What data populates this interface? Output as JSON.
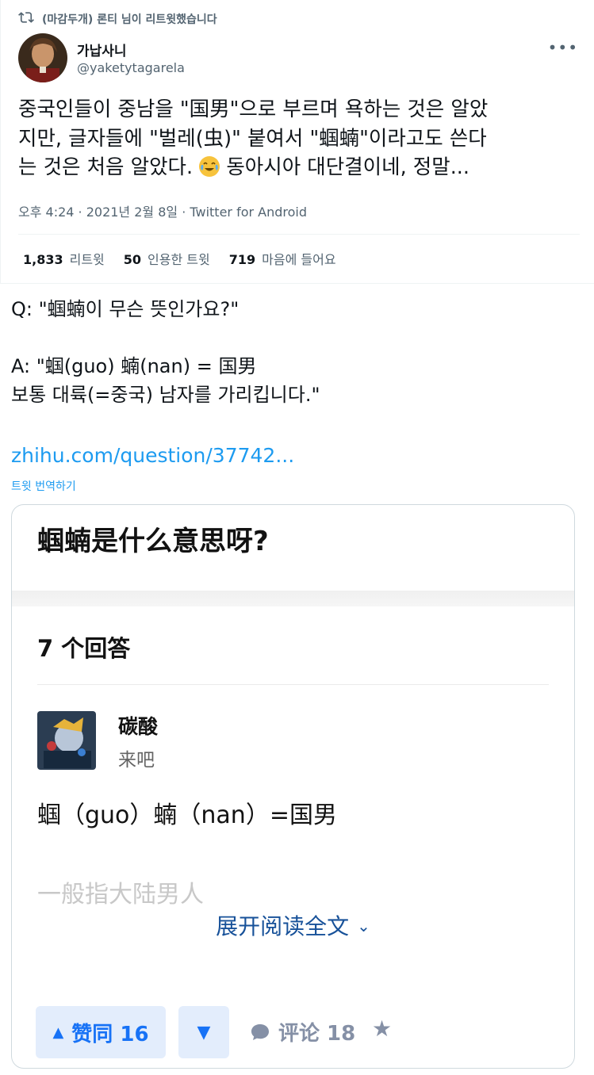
{
  "tweet": {
    "retweet_label": "(마감두개) 론티 님이 리트윗했습니다",
    "display_name": "가납사니",
    "handle": "@yaketytagarela",
    "more": "•••",
    "text_line1": "중국인들이 중남을 \"国男\"으로 부르며 욕하는 것은 알았",
    "text_line2": "지만, 글자들에 \"벌레(虫)\" 붙여서 \"蝈蝻\"이라고도 쓴다",
    "text_line3_a": "는 것은 처음 알았다.",
    "text_line3_b": "동아시아 대단결이네, 정말...",
    "emoji": "face-with-tears-of-joy",
    "meta": "오후 4:24 · 2021년 2월 8일 · Twitter for Android",
    "stats": [
      {
        "count": "1,833",
        "label": "리트윗"
      },
      {
        "count": "50",
        "label": "인용한 트윗"
      },
      {
        "count": "719",
        "label": "마음에 들어요"
      }
    ]
  },
  "qa": {
    "q": "Q: \"蝈蝻이 무슨 뜻인가요?\"",
    "a1": "A: \"蝈(guo) 蝻(nan) = 国男",
    "a2": "보통 대륙(=중국) 남자를 가리킵니다.\"",
    "link": "zhihu.com/question/37742...",
    "translate": "트윗 번역하기"
  },
  "card": {
    "question": "蝈蝻是什么意思呀?",
    "answer_count": "7 个回答",
    "author": "碳酸",
    "bio": "来吧",
    "answer": "蝈（guo）蝻（nan）=国男",
    "faded": "一般指大陆男人",
    "expand": "展开阅读全文",
    "upvote": "赞同 16",
    "comments": "评论 18"
  }
}
